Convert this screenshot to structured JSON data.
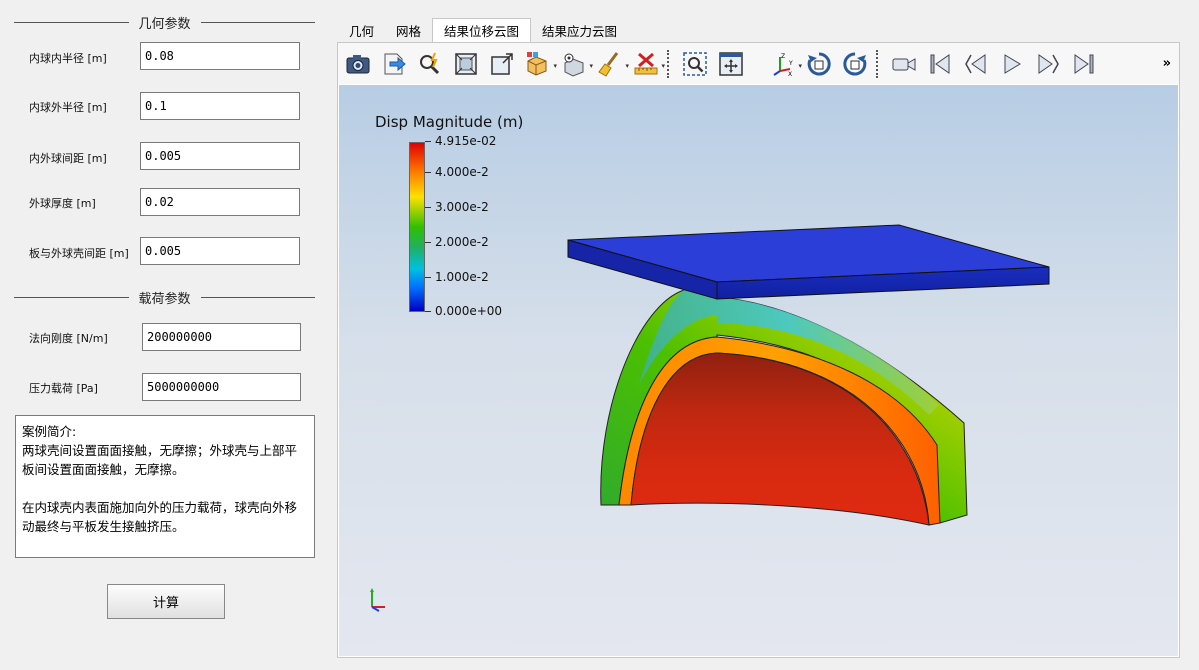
{
  "geometry": {
    "title": "几何参数",
    "params": [
      {
        "label": "内球内半径 [m]",
        "value": "0.08"
      },
      {
        "label": "内球外半径 [m]",
        "value": "0.1"
      },
      {
        "label": "内外球间距 [m]",
        "value": "0.005"
      },
      {
        "label": "外球厚度 [m]",
        "value": "0.02"
      },
      {
        "label": "板与外球壳间距 [m]",
        "value": "0.005"
      }
    ]
  },
  "load": {
    "title": "载荷参数",
    "params": [
      {
        "label": "法向刚度 [N/m]",
        "value": "200000000"
      },
      {
        "label": "压力载荷 [Pa]",
        "value": "5000000000"
      }
    ]
  },
  "description": "案例简介:\n两球壳间设置面面接触，无摩擦；外球壳与上部平板间设置面面接触，无摩擦。\n\n在内球壳内表面施加向外的压力载荷，球壳向外移动最终与平板发生接触挤压。",
  "calc_button": "计算",
  "tabs": [
    "几何",
    "网格",
    "结果位移云图",
    "结果应力云图"
  ],
  "active_tab": "结果位移云图",
  "toolbar_icons": [
    "camera-icon",
    "export-icon",
    "auto-icon",
    "fit-view-icon",
    "zoom-extents-icon",
    "block-icon",
    "show-block-icon",
    "clean-icon",
    "ruler-icon",
    "zoom-box-icon",
    "pan-icon",
    "axes-icon",
    "rotate-cw-icon",
    "rotate-ccw-icon",
    "video-icon",
    "first-frame-icon",
    "prev-frame-icon",
    "play-icon",
    "next-frame-icon",
    "last-frame-icon"
  ],
  "overflow": "»",
  "legend": {
    "title": "Disp Magnitude (m)",
    "ticks": [
      "4.915e-02",
      "4.000e-2",
      "3.000e-2",
      "2.000e-2",
      "1.000e-2",
      "0.000e+00"
    ]
  }
}
